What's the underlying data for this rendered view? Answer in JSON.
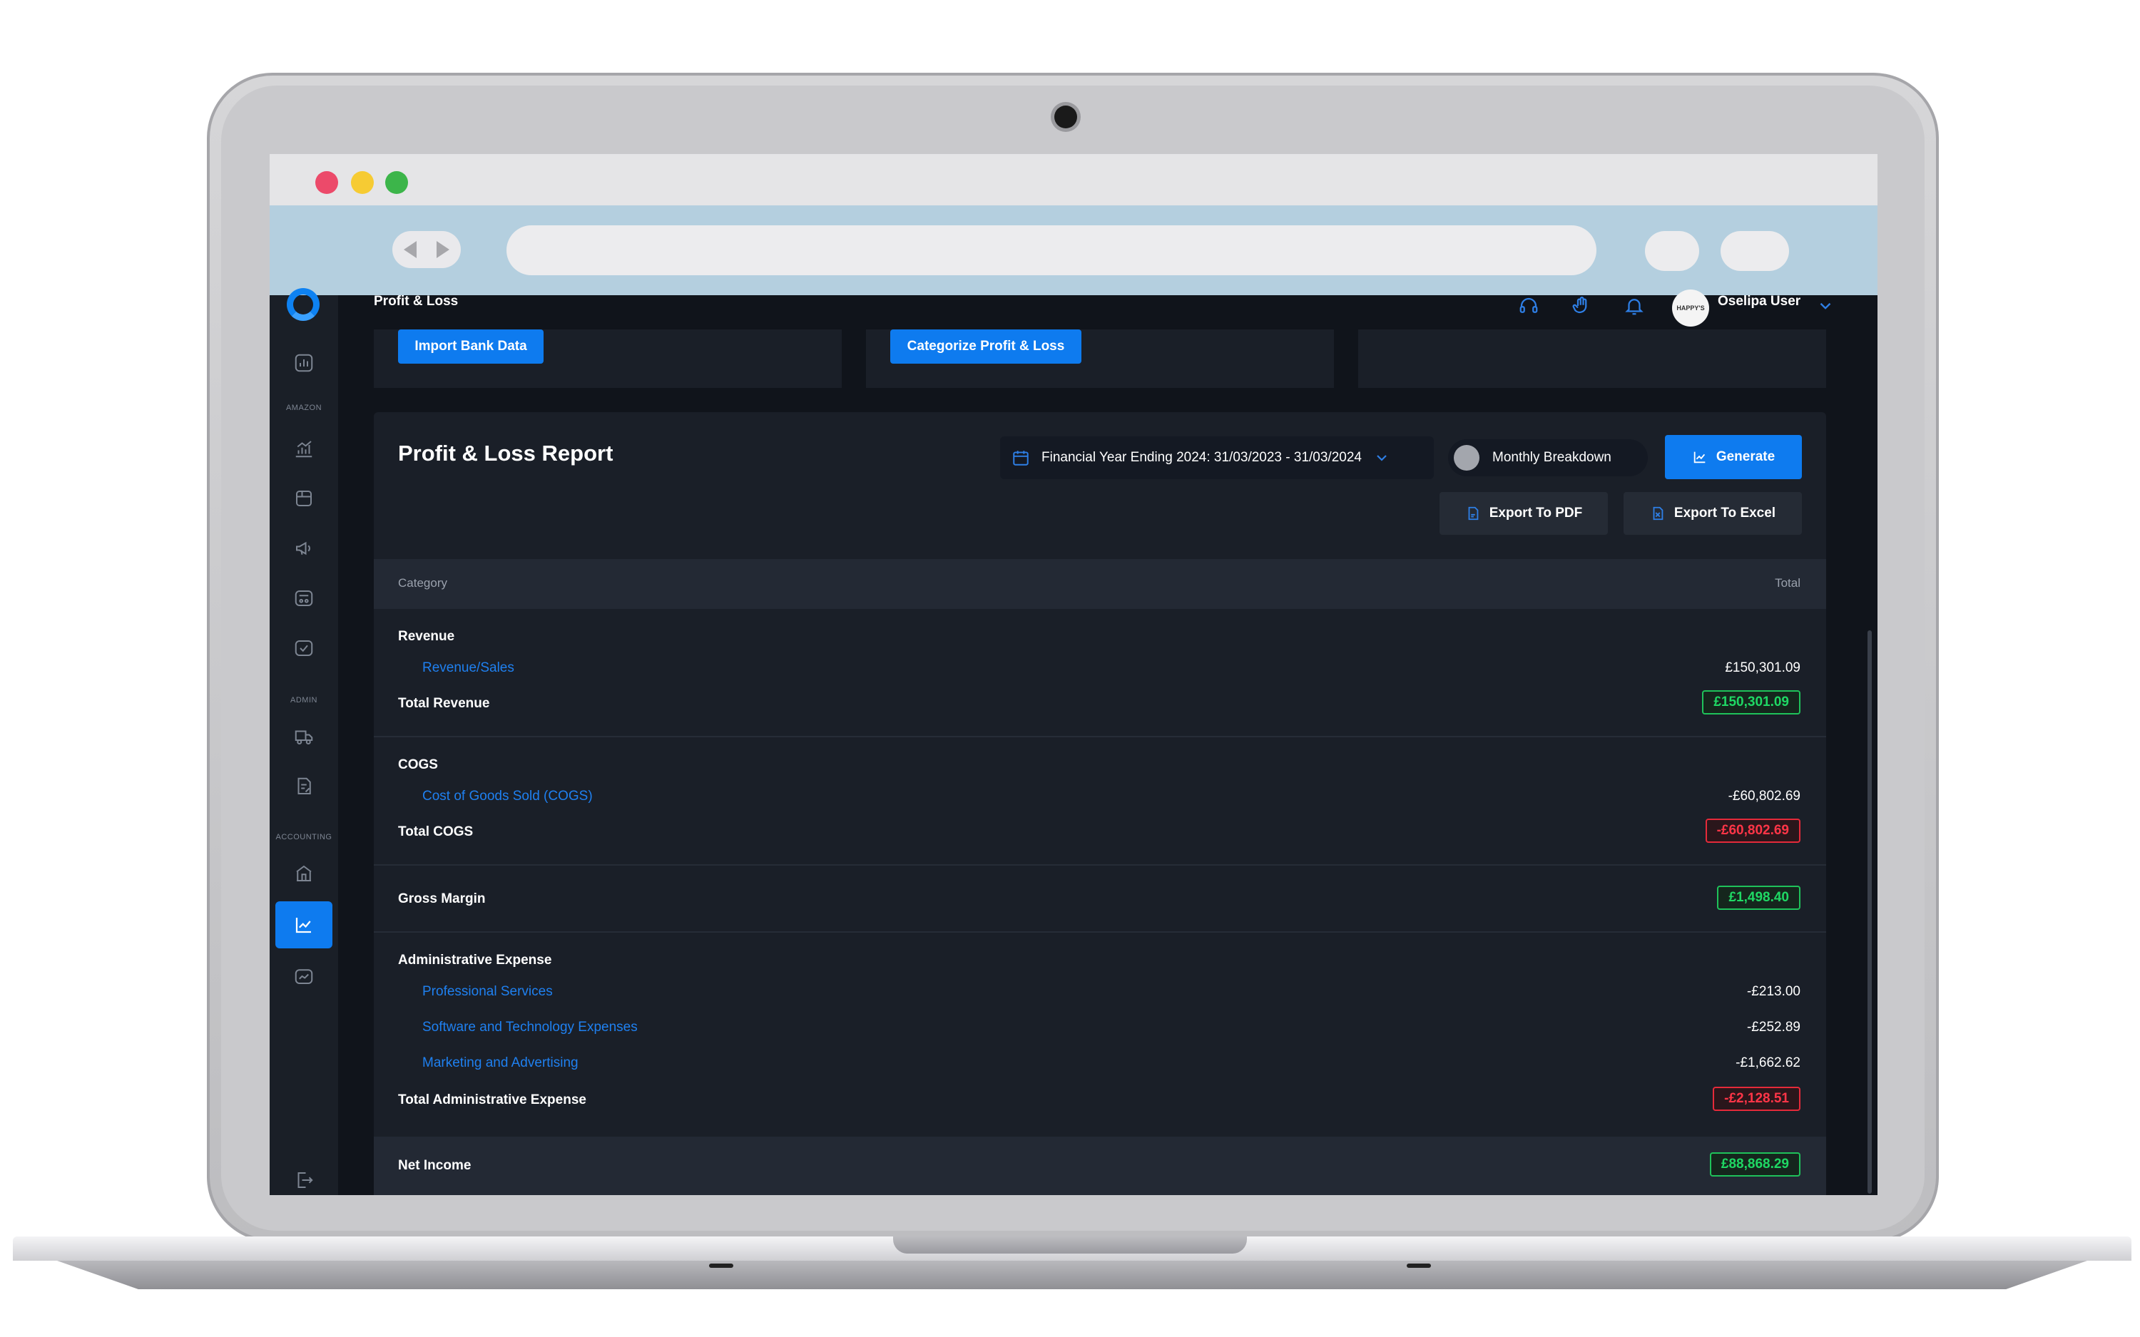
{
  "app": {
    "page_title": "Profit & Loss",
    "user_name": "Oselipa User",
    "avatar_text": "HAPPY'S"
  },
  "sidebar": {
    "sections": [
      "AMAZON",
      "ADMIN",
      "ACCOUNTING"
    ]
  },
  "top_cards": {
    "import_label": "Import Bank Data",
    "categorize_label": "Categorize Profit & Loss"
  },
  "report": {
    "title": "Profit & Loss Report",
    "period": "Financial Year Ending 2024: 31/03/2023 - 31/03/2024",
    "toggle_label": "Monthly Breakdown",
    "generate_label": "Generate",
    "export_pdf_label": "Export To PDF",
    "export_excel_label": "Export To Excel",
    "columns": {
      "category": "Category",
      "total": "Total"
    },
    "revenue": {
      "heading": "Revenue",
      "items": [
        {
          "name": "Revenue/Sales",
          "value": "£150,301.09"
        }
      ],
      "total_label": "Total Revenue",
      "total_value": "£150,301.09"
    },
    "cogs": {
      "heading": "COGS",
      "items": [
        {
          "name": "Cost of Goods Sold (COGS)",
          "value": "-£60,802.69"
        }
      ],
      "total_label": "Total COGS",
      "total_value": "-£60,802.69"
    },
    "gross_margin": {
      "label": "Gross Margin",
      "value": "£1,498.40"
    },
    "admin": {
      "heading": "Administrative Expense",
      "items": [
        {
          "name": "Professional Services",
          "value": "-£213.00"
        },
        {
          "name": "Software and Technology Expenses",
          "value": "-£252.89"
        },
        {
          "name": "Marketing and Advertising",
          "value": "-£1,662.62"
        }
      ],
      "total_label": "Total Administrative Expense",
      "total_value": "-£2,128.51"
    },
    "net_income": {
      "label": "Net Income",
      "value": "£88,868.29"
    }
  },
  "colors": {
    "accent": "#0e7bef",
    "positive": "#1fd864",
    "negative": "#ff3547",
    "background": "#10141b",
    "card": "#1a1f28"
  }
}
